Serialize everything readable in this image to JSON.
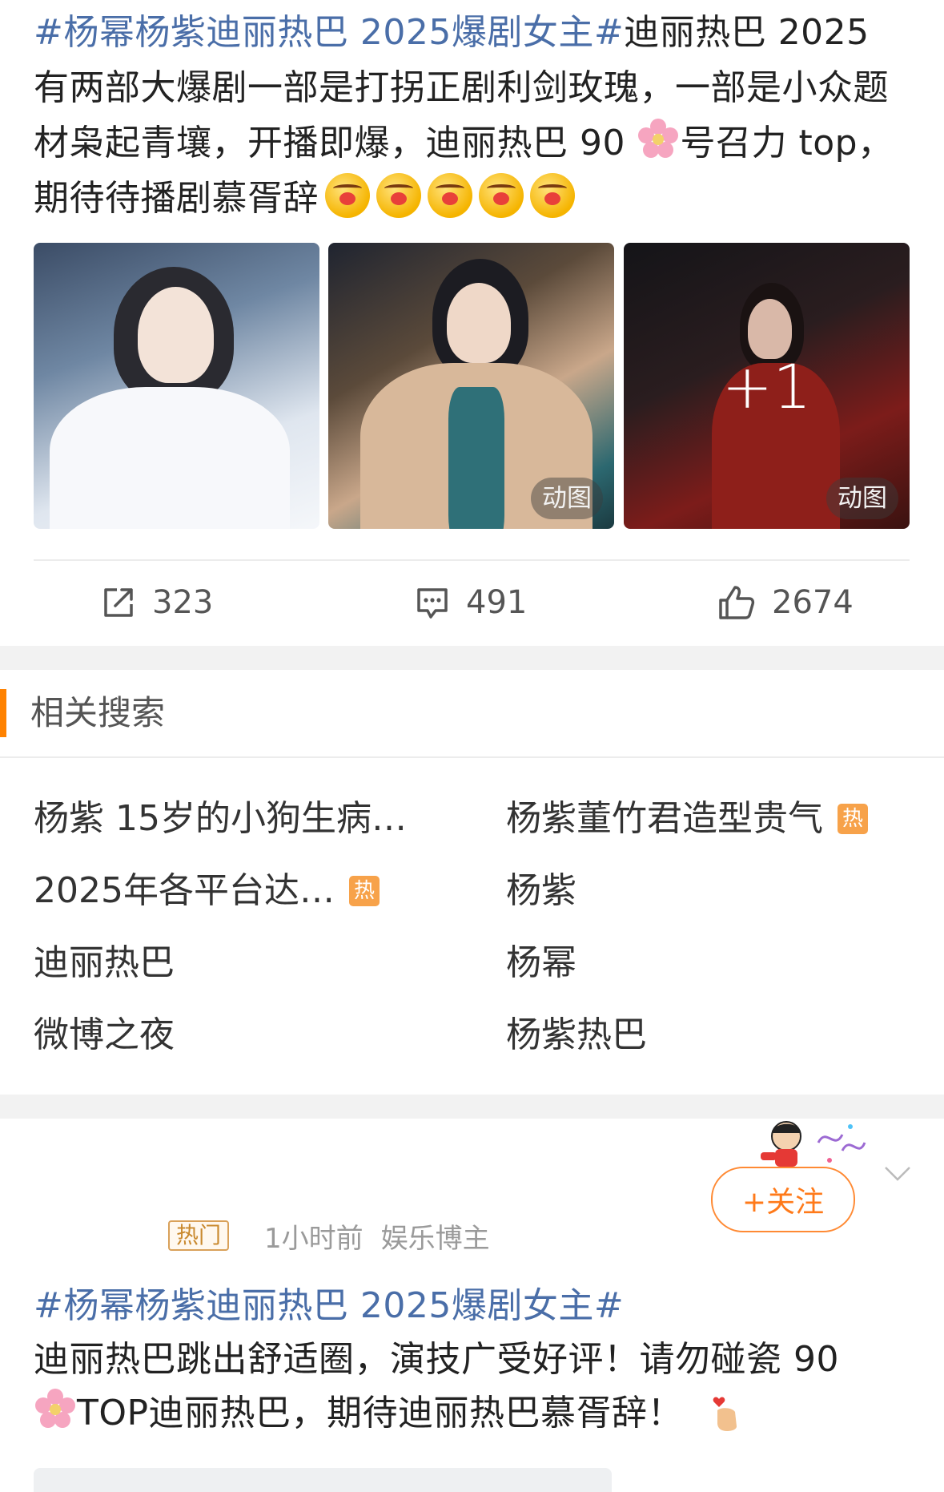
{
  "post1": {
    "topic": "#杨幂杨紫迪丽热巴 2025爆剧女主#",
    "text_a": "迪丽热巴 2025有两部大爆剧一部是打拐正剧利剑玫瑰，一部是小众题材枭起青壤，开播即爆，迪丽热巴 90",
    "blossom_emoji": "cherry-blossom-emoji",
    "text_b": "号召力 top，期待待播剧慕胥辞",
    "face_emoji": "excited-face-emoji",
    "face_emoji_count": 5
  },
  "images": {
    "badge_gif_2": "动图",
    "badge_gif_3": "动图",
    "more_count": "+1"
  },
  "actions": {
    "share_count": "323",
    "comment_count": "491",
    "like_count": "2674"
  },
  "related": {
    "title": "相关搜索",
    "items": [
      {
        "label": "杨紫 15岁的小狗生病…",
        "hot": false
      },
      {
        "label": "杨紫董竹君造型贵气",
        "hot": true
      },
      {
        "label": "2025年各平台达…",
        "hot": true
      },
      {
        "label": "杨紫",
        "hot": false
      },
      {
        "label": "迪丽热巴",
        "hot": false
      },
      {
        "label": "杨幂",
        "hot": false
      },
      {
        "label": "微博之夜",
        "hot": false
      },
      {
        "label": "杨紫热巴",
        "hot": false
      }
    ],
    "hot_tag": "热"
  },
  "post2": {
    "follow_label": "+关注",
    "hot_badge": "热门",
    "time": "1小时前",
    "author_type": "娱乐博主",
    "topic": "#杨幂杨紫迪丽热巴 2025爆剧女主#",
    "text_a": "迪丽热巴跳出舒适圈，演技广受好评！请勿碰瓷 90",
    "text_b": "TOP迪丽热巴，期待迪丽热巴慕胥辞！"
  },
  "colors": {
    "topic_blue": "#4a6ea8",
    "accent_orange": "#ff8200",
    "hot_tag": "#f7a24a"
  }
}
